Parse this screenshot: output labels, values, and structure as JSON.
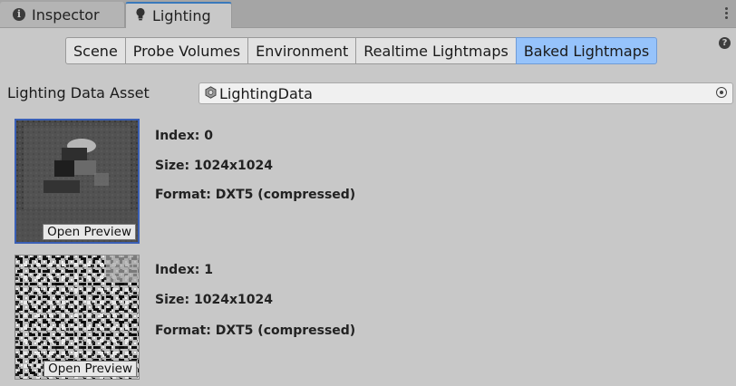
{
  "window_tabs": [
    {
      "label": "Inspector",
      "icon": "info-icon",
      "active": false
    },
    {
      "label": "Lighting",
      "icon": "lightbulb-icon",
      "active": true
    }
  ],
  "toolbar": {
    "tabs": [
      "Scene",
      "Probe Volumes",
      "Environment",
      "Realtime Lightmaps",
      "Baked Lightmaps"
    ],
    "selected": "Baked Lightmaps"
  },
  "help_icon": "question-icon",
  "lighting_data_asset": {
    "label": "Lighting Data Asset",
    "value": "LightingData"
  },
  "lightmaps": [
    {
      "index_text": "Index: 0",
      "size_text": "Size: 1024x1024",
      "format_text": "Format: DXT5 (compressed)",
      "preview_button": "Open Preview",
      "selected": true
    },
    {
      "index_text": "Index: 1",
      "size_text": "Size: 1024x1024",
      "format_text": "Format: DXT5 (compressed)",
      "preview_button": "Open Preview",
      "selected": false
    }
  ],
  "colors": {
    "panel": "#c8c8c8",
    "selected_tab": "#96c3fb",
    "selection_border": "#3a5fb5"
  }
}
